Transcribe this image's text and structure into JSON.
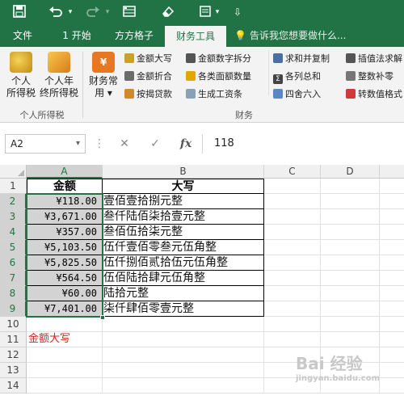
{
  "qat": {
    "save_icon": "save-icon",
    "undo_icon": "undo-icon",
    "redo_icon": "redo-icon",
    "form_icon": "form-icon",
    "eraser_icon": "eraser-icon",
    "customize_icon": "customize-icon"
  },
  "tabs": [
    {
      "label": "文件"
    },
    {
      "label": "1 开始"
    },
    {
      "label": "方方格子"
    },
    {
      "label": "财务工具",
      "active": true
    }
  ],
  "tell_me": "告诉我您想要做什么...",
  "ribbon": {
    "group1": {
      "btn1": "个人\n所得税",
      "btn2": "个人年\n终所得税",
      "name": "个人所得税"
    },
    "group2": {
      "big": "财务常\n用",
      "small": [
        "金额大写",
        "金额折合",
        "按揭贷款",
        "金额数字拆分",
        "各类面额数量",
        "生成工资条",
        "求和并复制",
        "各列总和",
        "四舍六入",
        "插值法求解",
        "整数补零",
        "转数值格式"
      ],
      "name": "财务"
    }
  },
  "formula_bar": {
    "name_box": "A2",
    "cancel": "✕",
    "enter": "✓",
    "fx": "fx",
    "value": "118"
  },
  "columns": [
    "A",
    "B",
    "C",
    "D"
  ],
  "rows": [
    "1",
    "2",
    "3",
    "4",
    "5",
    "6",
    "7",
    "8",
    "9",
    "10",
    "11",
    "12",
    "13",
    "14"
  ],
  "table": {
    "header_amount": "金额",
    "header_upper": "大写",
    "amounts": [
      "¥118.00",
      "¥3,671.00",
      "¥357.00",
      "¥5,103.50",
      "¥5,825.50",
      "¥564.50",
      "¥60.00",
      "¥7,401.00"
    ],
    "uppers": [
      "壹佰壹拾捌元整",
      "叁仟陆佰柒拾壹元整",
      "叁佰伍拾柒元整",
      "伍仟壹佰零叁元伍角整",
      "伍仟捌佰贰拾伍元伍角整",
      "伍佰陆拾肆元伍角整",
      "陆拾元整",
      "柒仟肆佰零壹元整"
    ]
  },
  "note": "金额大写",
  "watermark": "Bai 经验",
  "watermark_sub": "jingyan.baidu.com"
}
